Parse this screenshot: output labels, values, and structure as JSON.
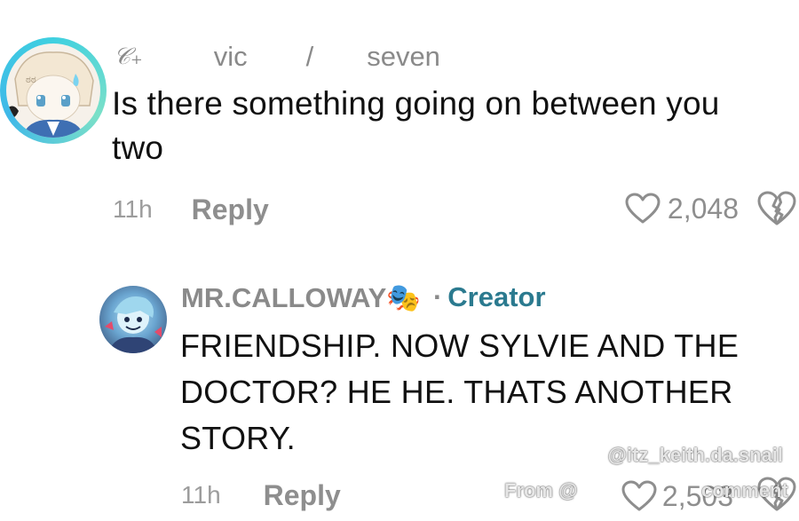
{
  "comment": {
    "username_glyph": "𝒞₊",
    "username_part1": "vic",
    "username_sep": "/",
    "username_part2": "seven",
    "text": "Is there something going on between you two",
    "time": "11h",
    "reply_label": "Reply",
    "likes": "2,048"
  },
  "reply": {
    "author": "MR.CALLOWAY🎭",
    "separator": "·",
    "badge": "Creator",
    "text": "FRIENDSHIP. NOW SYLVIE AND THE DOCTOR? HE HE. THATS ANOTHER STORY.",
    "time": "11h",
    "reply_label": "Reply",
    "likes": "2,503"
  },
  "watermark": {
    "handle": "@itz_keith.da.snail",
    "from": "From @",
    "comment": "comment"
  },
  "colors": {
    "text": "#111111",
    "meta": "#8e8e8e",
    "creator": "#2b7a8f",
    "avatar_ring": "#3fd0e0"
  }
}
